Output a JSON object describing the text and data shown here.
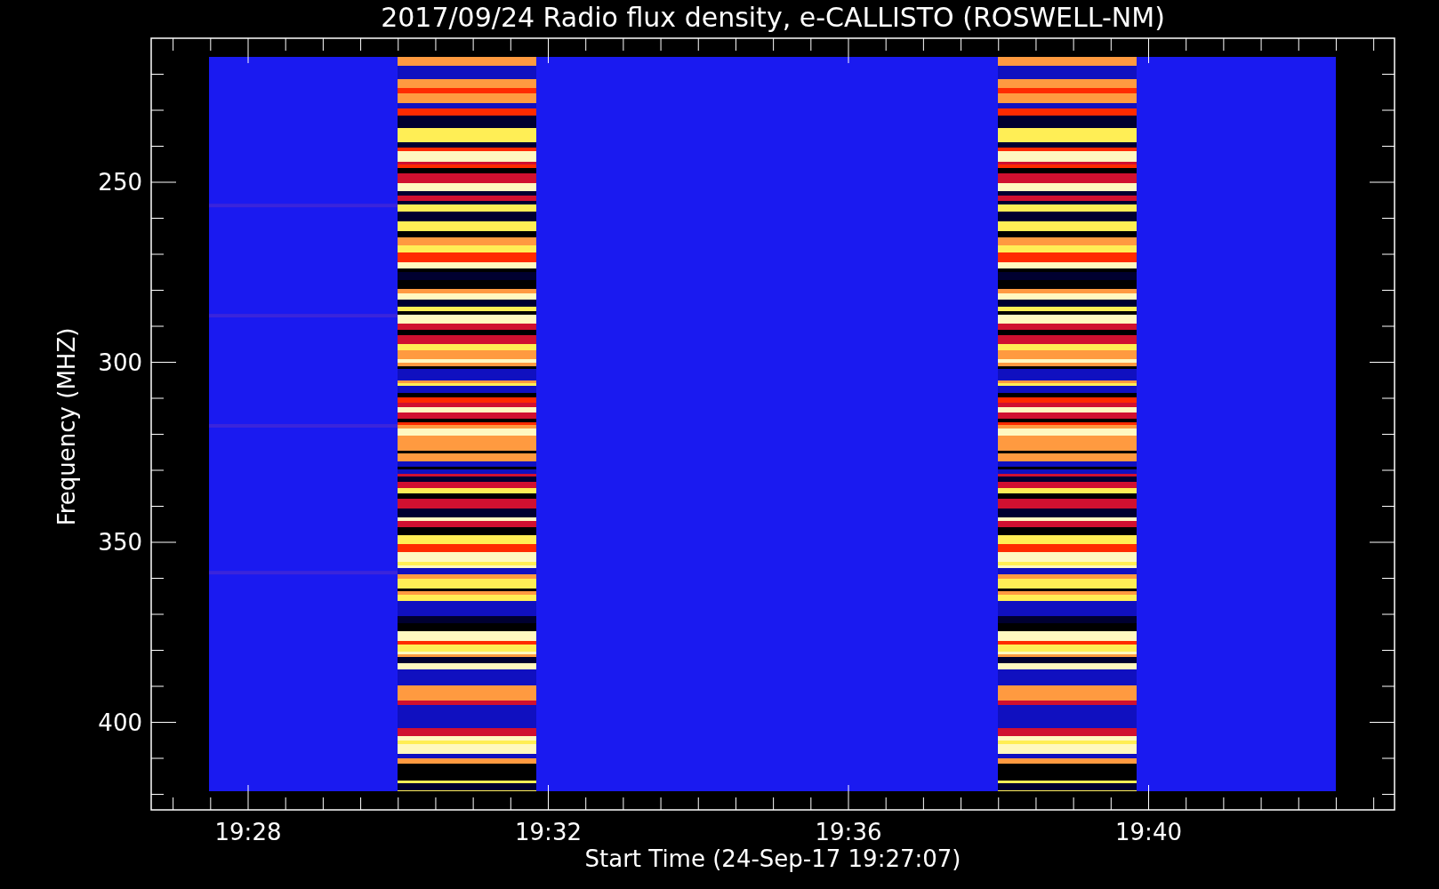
{
  "title": "2017/09/24  Radio flux density, e-CALLISTO (ROSWELL-NM)",
  "y_axis": {
    "label": "Frequency (MHZ)",
    "ticks": [
      "250",
      "300",
      "350",
      "400"
    ]
  },
  "x_axis": {
    "label": "Start Time (24-Sep-17 19:27:07)",
    "ticks": [
      "19:28",
      "19:32",
      "19:36",
      "19:40"
    ]
  }
}
